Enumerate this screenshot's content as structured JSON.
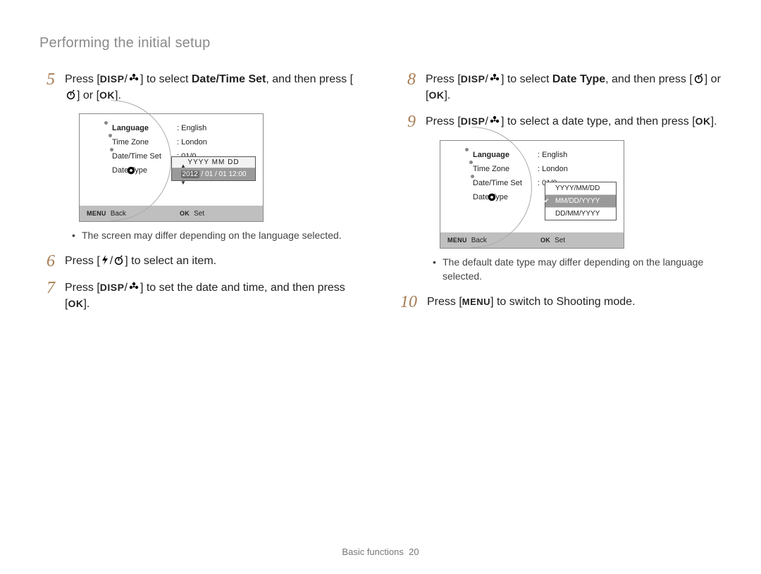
{
  "header": {
    "title": "Performing the initial setup"
  },
  "icons": {
    "disp": "DISP",
    "ok": "OK",
    "menu": "MENU"
  },
  "steps": {
    "s5": {
      "num": "5",
      "t1": "Press [",
      "t2": "/",
      "t3": "] to select ",
      "bold": "Date/Time Set",
      "t4": ", and then press [",
      "t5": "] or [",
      "t6": "]."
    },
    "s6": {
      "num": "6",
      "t1": "Press [",
      "t2": "/",
      "t3": "] to select an item."
    },
    "s7": {
      "num": "7",
      "t1": "Press [",
      "t2": "/",
      "t3": "] to set the date and time, and then press [",
      "t4": "]."
    },
    "s8": {
      "num": "8",
      "t1": "Press [",
      "t2": "/",
      "t3": "] to select ",
      "bold": "Date Type",
      "t4": ", and then press [",
      "t5": "] or [",
      "t6": "]."
    },
    "s9": {
      "num": "9",
      "t1": "Press [",
      "t2": "/",
      "t3": "] to select a date type, and then press [",
      "t4": "]."
    },
    "s10": {
      "num": "10",
      "t1": "Press [",
      "t2": "] to switch to Shooting mode."
    }
  },
  "notes": {
    "n1": "The screen may differ depending on the language selected.",
    "n2": "The default date type may differ depending on the language selected."
  },
  "lcd1": {
    "rows": {
      "language": {
        "label": "Language",
        "value": ": English",
        "bold": true
      },
      "timezone": {
        "label": "Time Zone",
        "value": ": London"
      },
      "datetime": {
        "label": "Date/Time Set",
        "value": ": 01/0…"
      },
      "datetype": {
        "label": "Date Type",
        "value": ""
      }
    },
    "popup": {
      "header": "YYYY MM DD",
      "year": "2012",
      "rest": " / 01 / 01 12:00"
    },
    "footer": {
      "backLabel": "Back",
      "setLabel": "Set",
      "menu": "MENU",
      "ok": "OK"
    }
  },
  "lcd2": {
    "rows": {
      "language": {
        "label": "Language",
        "value": ": English",
        "bold": true
      },
      "timezone": {
        "label": "Time Zone",
        "value": ": London"
      },
      "datetime": {
        "label": "Date/Time Set",
        "value": ": 01/0…"
      },
      "datetype": {
        "label": "Date Type",
        "value": ""
      }
    },
    "popup": {
      "opt1": "YYYY/MM/DD",
      "opt2": "MM/DD/YYYY",
      "opt3": "DD/MM/YYYY"
    },
    "footer": {
      "backLabel": "Back",
      "setLabel": "Set",
      "menu": "MENU",
      "ok": "OK"
    }
  },
  "footer": {
    "section": "Basic functions",
    "page": "20"
  }
}
